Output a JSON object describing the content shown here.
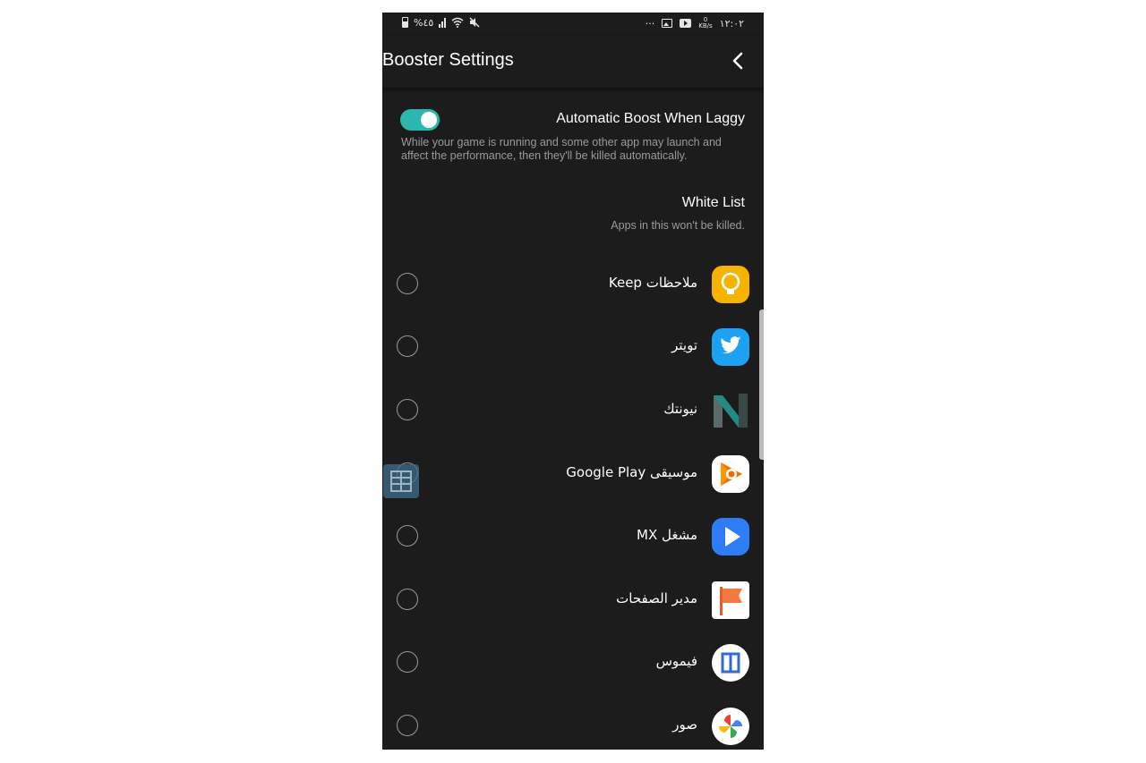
{
  "status_bar": {
    "battery_text": "%٤٥",
    "network_speed_value": "0",
    "network_speed_unit": "KB/s",
    "time": "١٢:٠٢",
    "more_glyph": "···"
  },
  "header": {
    "title": "Booster Settings",
    "back_icon": "chevron-left-icon"
  },
  "automatic_boost": {
    "title": "Automatic Boost When Laggy",
    "description": "While your game is running and some other app may launch and affect the performance, then they'll be killed automatically.",
    "enabled": true,
    "accent_color": "#2ab7b0"
  },
  "white_list": {
    "title": "White List",
    "subtitle": "Apps in this won't be killed.",
    "apps": [
      {
        "name": "ملاحظات Keep",
        "icon": "keep-icon",
        "selected": false
      },
      {
        "name": "تويتر",
        "icon": "twitter-icon",
        "selected": false
      },
      {
        "name": "نيونتك",
        "icon": "nova-icon",
        "selected": false
      },
      {
        "name": "موسيقى Google Play",
        "icon": "google-play-music-icon",
        "selected": false
      },
      {
        "name": "مشغل MX",
        "icon": "mx-player-icon",
        "selected": false
      },
      {
        "name": "مدير الصفحات",
        "icon": "pages-manager-icon",
        "selected": false
      },
      {
        "name": "فيموس",
        "icon": "vimos-icon",
        "selected": false
      },
      {
        "name": "صور",
        "icon": "google-photos-icon",
        "selected": false
      }
    ]
  }
}
